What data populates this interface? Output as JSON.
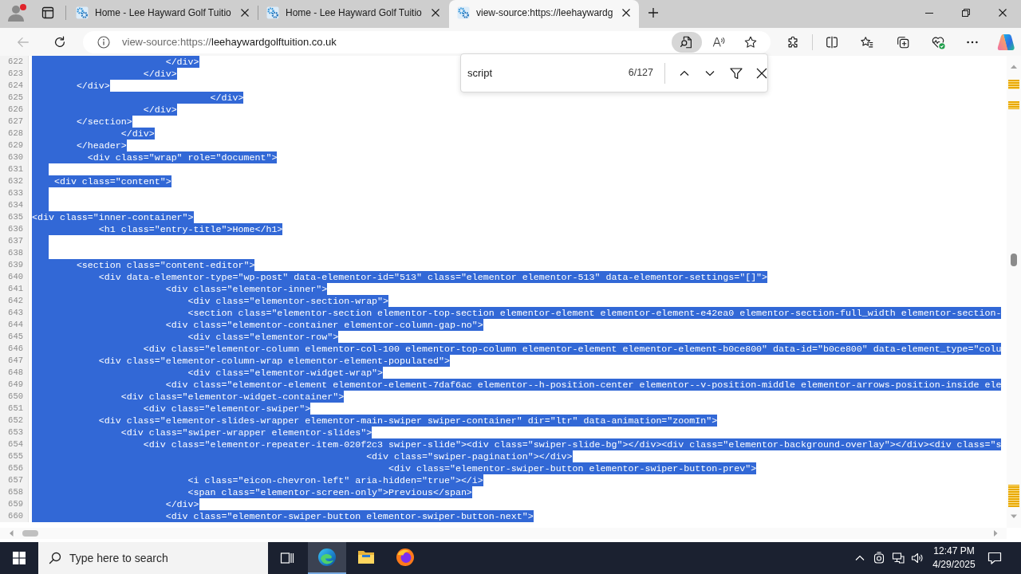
{
  "window": {
    "tabs": [
      {
        "title": "Home - Lee Hayward Golf Tuitio",
        "selected": false
      },
      {
        "title": "Home - Lee Hayward Golf Tuitio",
        "selected": false
      },
      {
        "title": "view-source:https://leehaywardg",
        "selected": true
      }
    ]
  },
  "toolbar": {
    "back_disabled": true,
    "url_prefix": "view-source:https://",
    "url_domain": "leehaywardgolftuition.co.uk",
    "find_active": true
  },
  "find_bar": {
    "query": "script",
    "count": "6/127"
  },
  "source": {
    "lines": [
      {
        "number": "622",
        "text": "                        </div>",
        "selected": true
      },
      {
        "number": "623",
        "text": "                    </div>",
        "selected": true
      },
      {
        "number": "624",
        "text": "        </div>",
        "selected": true
      },
      {
        "number": "625",
        "text": "                                </div>",
        "selected": true
      },
      {
        "number": "626",
        "text": "                    </div>",
        "selected": true
      },
      {
        "number": "627",
        "text": "        </section>",
        "selected": true
      },
      {
        "number": "628",
        "text": "                </div>",
        "selected": true
      },
      {
        "number": "629",
        "text": "        </header>",
        "selected": true
      },
      {
        "number": "630",
        "text": "          <div class=\"wrap\" role=\"document\">",
        "selected": true
      },
      {
        "number": "631",
        "selected": true
      },
      {
        "number": "632",
        "text": "    <div class=\"content\">",
        "selected": true
      },
      {
        "number": "633",
        "selected": true
      },
      {
        "number": "634",
        "selected": true
      },
      {
        "number": "635",
        "text": "<div class=\"inner-container\">",
        "selected": true
      },
      {
        "number": "636",
        "text": "            <h1 class=\"entry-title\">Home</h1>",
        "selected": true
      },
      {
        "number": "637",
        "selected": true
      },
      {
        "number": "638",
        "selected": true
      },
      {
        "number": "639",
        "text": "        <section class=\"content-editor\">",
        "selected": true
      },
      {
        "number": "640",
        "text": "            <div data-elementor-type=\"wp-post\" data-elementor-id=\"513\" class=\"elementor elementor-513\" data-elementor-settings=\"[]\">",
        "selected": true
      },
      {
        "number": "641",
        "text": "                        <div class=\"elementor-inner\">",
        "selected": true
      },
      {
        "number": "642",
        "text": "                            <div class=\"elementor-section-wrap\">",
        "selected": true
      },
      {
        "number": "643",
        "text": "                            <section class=\"elementor-section elementor-top-section elementor-element elementor-element-e42ea0 elementor-section-full_width elementor-section-",
        "selected": true
      },
      {
        "number": "644",
        "text": "                        <div class=\"elementor-container elementor-column-gap-no\">",
        "selected": true
      },
      {
        "number": "645",
        "text": "                            <div class=\"elementor-row\">",
        "selected": true
      },
      {
        "number": "646",
        "text": "                    <div class=\"elementor-column elementor-col-100 elementor-top-column elementor-element elementor-element-b0ce800\" data-id=\"b0ce800\" data-element_type=\"colu",
        "selected": true
      },
      {
        "number": "647",
        "text": "            <div class=\"elementor-column-wrap elementor-element-populated\">",
        "selected": true
      },
      {
        "number": "648",
        "text": "                            <div class=\"elementor-widget-wrap\">",
        "selected": true
      },
      {
        "number": "649",
        "text": "                        <div class=\"elementor-element elementor-element-7daf6ac elementor--h-position-center elementor--v-position-middle elementor-arrows-position-inside ele",
        "selected": true
      },
      {
        "number": "650",
        "text": "                <div class=\"elementor-widget-container\">",
        "selected": true
      },
      {
        "number": "651",
        "text": "                    <div class=\"elementor-swiper\">",
        "selected": true
      },
      {
        "number": "652",
        "text": "            <div class=\"elementor-slides-wrapper elementor-main-swiper swiper-container\" dir=\"ltr\" data-animation=\"zoomIn\">",
        "selected": true
      },
      {
        "number": "653",
        "text": "                <div class=\"swiper-wrapper elementor-slides\">",
        "selected": true
      },
      {
        "number": "654",
        "text": "                    <div class=\"elementor-repeater-item-020f2c3 swiper-slide\"><div class=\"swiper-slide-bg\"></div><div class=\"elementor-background-overlay\"></div><div class=\"s",
        "selected": true
      },
      {
        "number": "655",
        "text": "                                                            <div class=\"swiper-pagination\"></div>",
        "selected": true
      },
      {
        "number": "656",
        "text": "                                                                <div class=\"elementor-swiper-button elementor-swiper-button-prev\">",
        "selected": true
      },
      {
        "number": "657",
        "text": "                            <i class=\"eicon-chevron-left\" aria-hidden=\"true\"></i>",
        "selected": true
      },
      {
        "number": "658",
        "text": "                            <span class=\"elementor-screen-only\">Previous</span>",
        "selected": true
      },
      {
        "number": "659",
        "text": "                        </div>",
        "selected": true
      },
      {
        "number": "660",
        "text": "                        <div class=\"elementor-swiper-button elementor-swiper-button-next\">",
        "selected": true
      }
    ]
  },
  "taskbar": {
    "search_placeholder": "Type here to search",
    "apps": [
      {
        "kind": "edge",
        "active": true
      },
      {
        "kind": "explorer",
        "active": false
      },
      {
        "kind": "firefox",
        "active": false
      }
    ],
    "time": "12:47 PM",
    "date": "4/29/2025"
  }
}
